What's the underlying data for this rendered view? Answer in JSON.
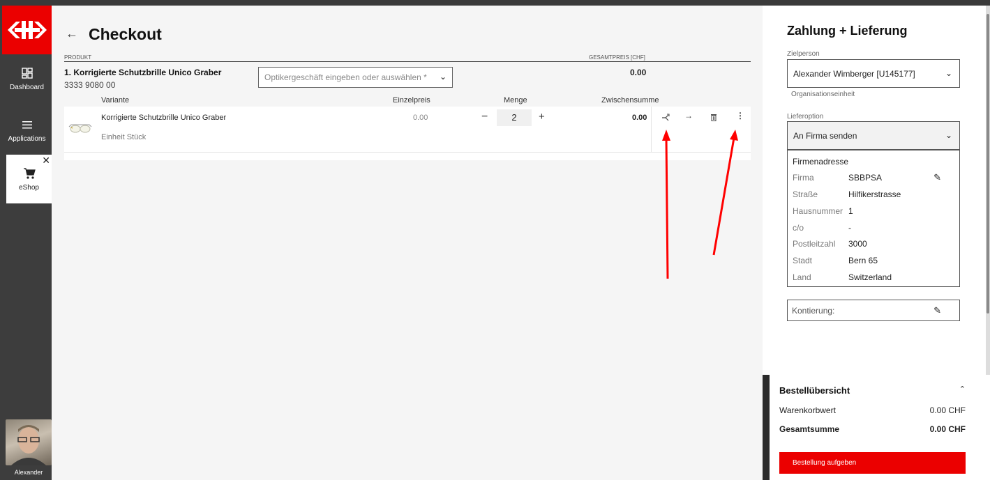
{
  "nav": {
    "dashboard": "Dashboard",
    "applications": "Applications",
    "eshop": "eShop",
    "user_name": "Alexander"
  },
  "checkout": {
    "title": "Checkout",
    "col_product": "PRODUKT",
    "col_total": "GESAMTPREIS [CHF]",
    "product_name": "1.  Korrigierte Schutzbrille Unico Graber",
    "product_number": "3333 9080 00",
    "optician_placeholder": "Optikergeschäft eingeben oder auswählen *",
    "product_total": "0.00",
    "col_variant": "Variante",
    "col_unit_price": "Einzelpreis",
    "col_quantity": "Menge",
    "col_subtotal": "Zwischensumme",
    "variant_name": "Korrigierte Schutzbrille Unico Graber",
    "variant_unit": "Einheit Stück",
    "unit_price": "0.00",
    "quantity": "2",
    "subtotal": "0.00"
  },
  "payment": {
    "title": "Zahlung + Lieferung",
    "target_label": "Zielperson",
    "target_value": "Alexander Wimberger [U145177]",
    "org_unit_label": "Organisationseinheit",
    "delivery_label": "Lieferoption",
    "delivery_value": "An Firma senden",
    "address_title": "Firmenadresse",
    "address": [
      {
        "key": "Firma",
        "value": "SBBPSA"
      },
      {
        "key": "Straße",
        "value": "Hilfikerstrasse"
      },
      {
        "key": "Hausnummer",
        "value": "1"
      },
      {
        "key": "c/o",
        "value": "-"
      },
      {
        "key": "Postleitzahl",
        "value": "3000"
      },
      {
        "key": "Stadt",
        "value": "Bern 65"
      },
      {
        "key": "Land",
        "value": "Switzerland"
      }
    ],
    "kontierung": "Kontierung:"
  },
  "summary": {
    "title": "Bestellübersicht",
    "cart_value_label": "Warenkorbwert",
    "cart_value": "0.00 CHF",
    "total_label": "Gesamtsumme",
    "total_value": "0.00 CHF",
    "order_button": "Bestellung aufgeben"
  },
  "colors": {
    "brand_red": "#eb0000",
    "annotation_red": "#ff0000"
  },
  "icons": [
    "sbb-logo-icon",
    "dashboard-icon",
    "menu-icon",
    "cart-icon",
    "close-icon",
    "back-arrow-icon",
    "chevron-down-icon",
    "split-icon",
    "arrow-right-icon",
    "trash-icon",
    "more-vert-icon",
    "pencil-icon",
    "chevron-up-icon"
  ]
}
